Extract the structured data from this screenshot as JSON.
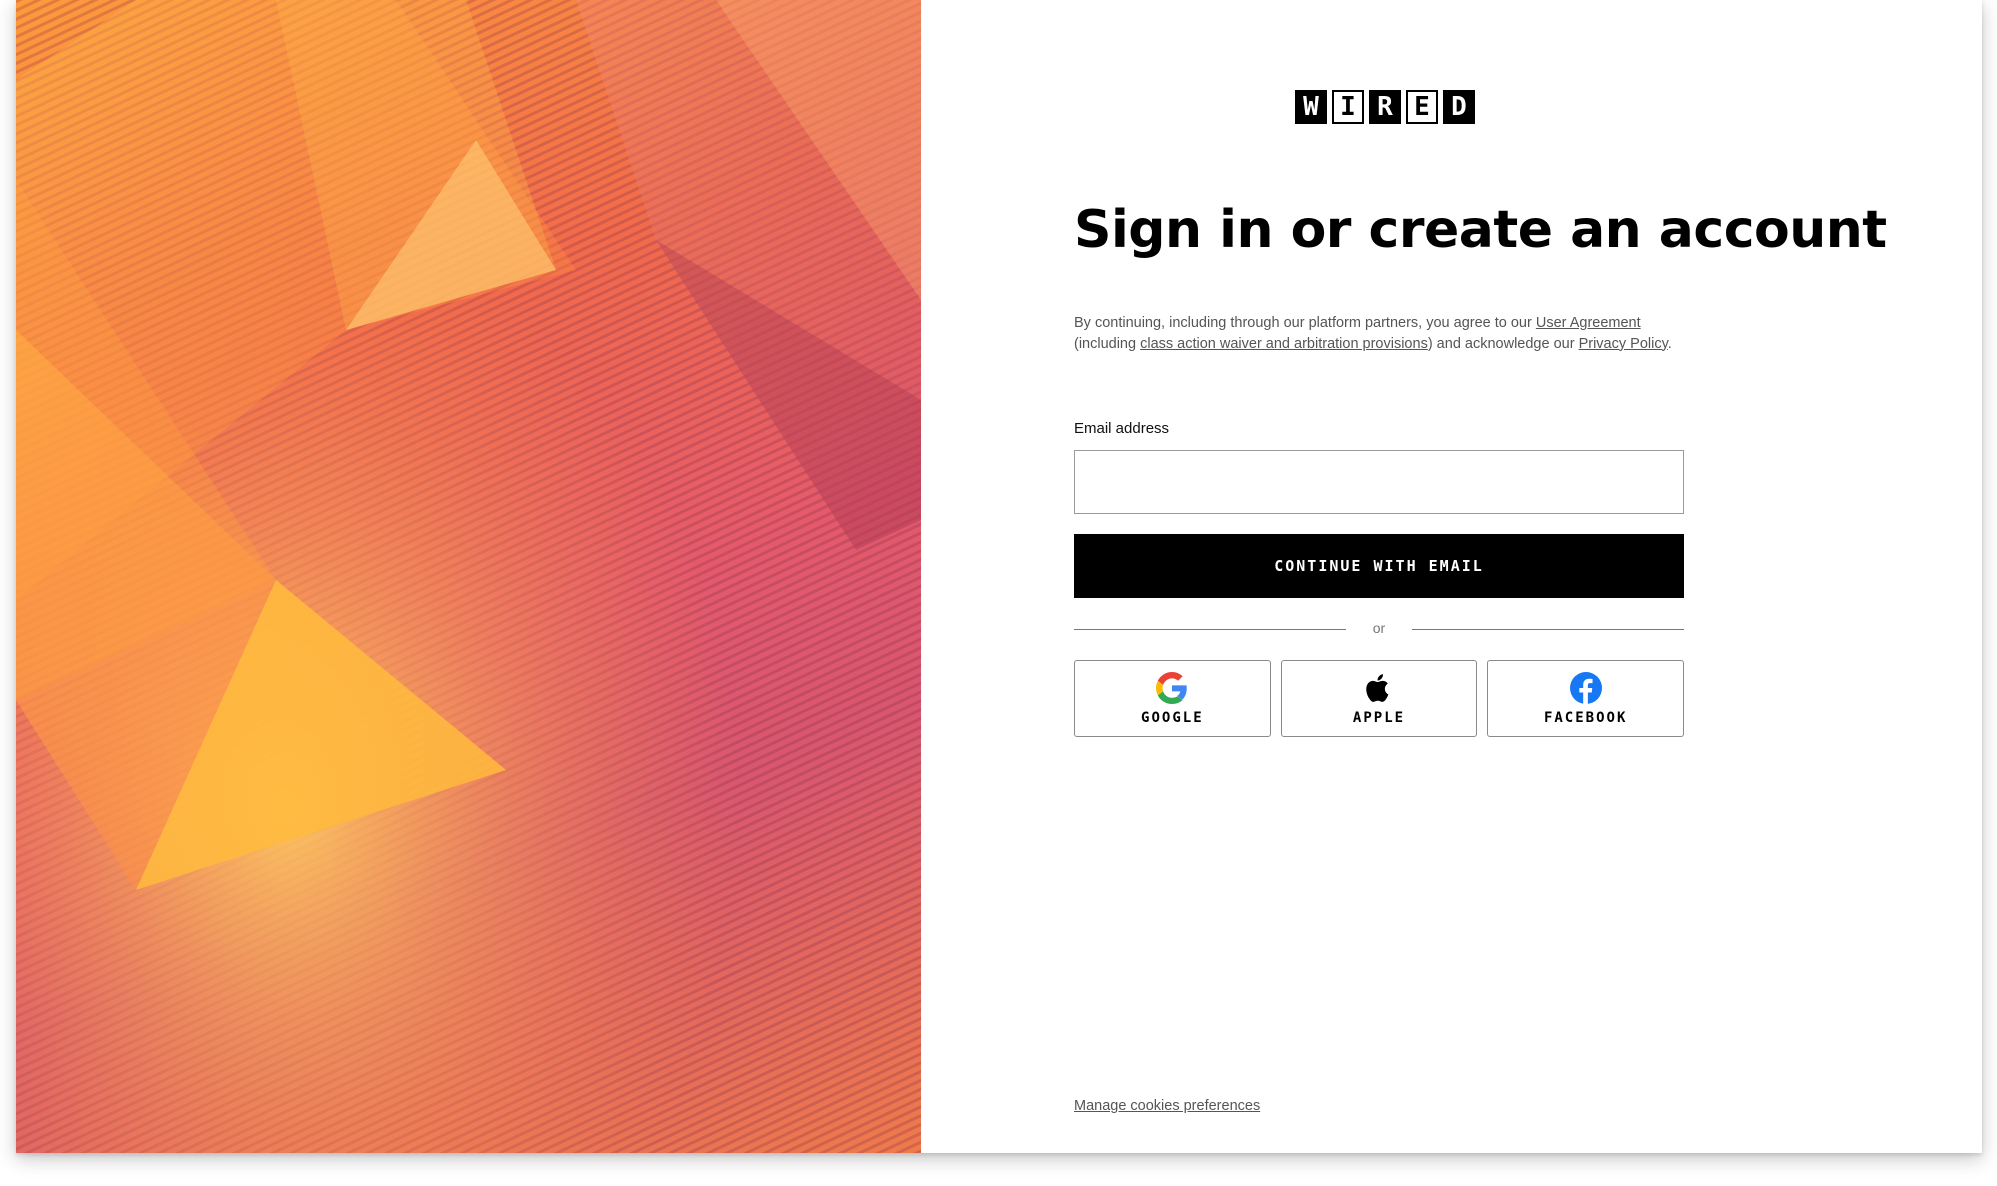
{
  "brand": {
    "logo_letters": [
      "W",
      "I",
      "R",
      "E",
      "D"
    ],
    "logo_alt": "WIRED"
  },
  "page": {
    "title": "Sign in or create an account"
  },
  "legal": {
    "text_1": "By continuing, including through our platform partners, you agree to our ",
    "link_user_agreement": "User Agreement",
    "text_2": " (including ",
    "link_class_action": "class action waiver and arbitration provisions",
    "text_3": ") and acknowledge our ",
    "link_privacy": "Privacy Policy",
    "text_4": "."
  },
  "form": {
    "email_label": "Email address",
    "email_value": "",
    "email_placeholder": "",
    "continue_label": "CONTINUE WITH EMAIL",
    "divider_text": "or"
  },
  "social": [
    {
      "label": "GOOGLE",
      "icon": "google-icon"
    },
    {
      "label": "APPLE",
      "icon": "apple-icon"
    },
    {
      "label": "FACEBOOK",
      "icon": "facebook-icon"
    }
  ],
  "footer": {
    "cookies_link": "Manage cookies preferences"
  },
  "colors": {
    "button_bg": "#000000",
    "button_text": "#ffffff",
    "link_gray": "#555555",
    "facebook_blue": "#1877f2",
    "hero_orange": "#ff9a3c",
    "hero_pink": "#d9566f"
  }
}
